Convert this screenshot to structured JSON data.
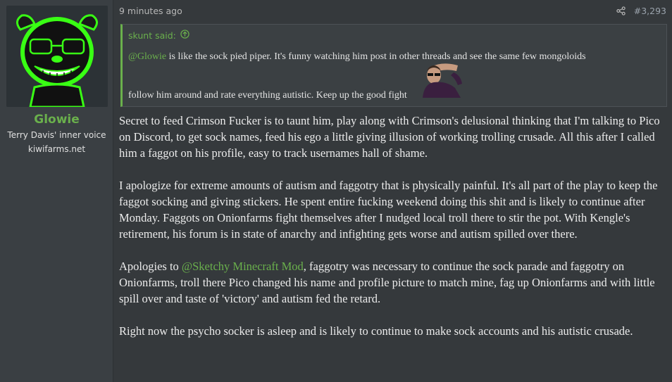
{
  "colors": {
    "accent": "#6ab04c",
    "background": "#35393c",
    "user_column": "#3a3f43",
    "quote_background": "#3b4043",
    "text": "#ececec",
    "muted": "#b7b7b7"
  },
  "user": {
    "name": "Glowie",
    "title": "Terry Davis' inner voice",
    "domain": "kiwifarms.net",
    "avatar_icon": "green-neon-dog-avatar"
  },
  "meta": {
    "timestamp": "9 minutes ago",
    "share_icon": "share-icon",
    "post_number": "#3,293"
  },
  "quote": {
    "author_label": "skunt said:",
    "jump_icon": "arrow-up-circle-icon",
    "line1_mention": "@Glowie",
    "line1_text": " is like the sock pied piper. It's funny watching him post in other threads and see the same few mongoloids",
    "line2_text": "follow him around and rate everything autistic. Keep up the good fight",
    "reaction_image": "man-with-sunglasses-saluting-image"
  },
  "body": {
    "p1": "Secret to feed Crimson Fucker is to taunt him, play along with Crimson's delusional thinking that I'm talking to Pico on Discord, to get sock names, feed his ego a little giving illusion of working trolling crusade. All this after I called him a faggot on his profile, easy to track usernames hall of shame.",
    "p2": "I apologize for extreme amounts of autism and faggotry that is physically painful. It's all part of the play to keep the faggot socking and giving stickers. He spent entire fucking weekend doing this shit and is likely to continue after Monday. Faggots on Onionfarms fight themselves after I nudged local troll there to stir the pot. With Kengle's retirement, his forum is in state of anarchy and infighting gets worse and autism spilled over there.",
    "p3_prefix": "Apologies to ",
    "p3_mention": "@Sketchy Minecraft Mod",
    "p3_suffix": ", faggotry was necessary to continue the sock parade and faggotry on Onionfarms, troll there Pico changed his name and profile picture to match mine, fag up Onionfarms and with little spill over and taste of 'victory' and autism fed the retard.",
    "p4": "Right now the psycho socker is asleep and is likely to continue to make sock accounts and his autistic crusade."
  }
}
